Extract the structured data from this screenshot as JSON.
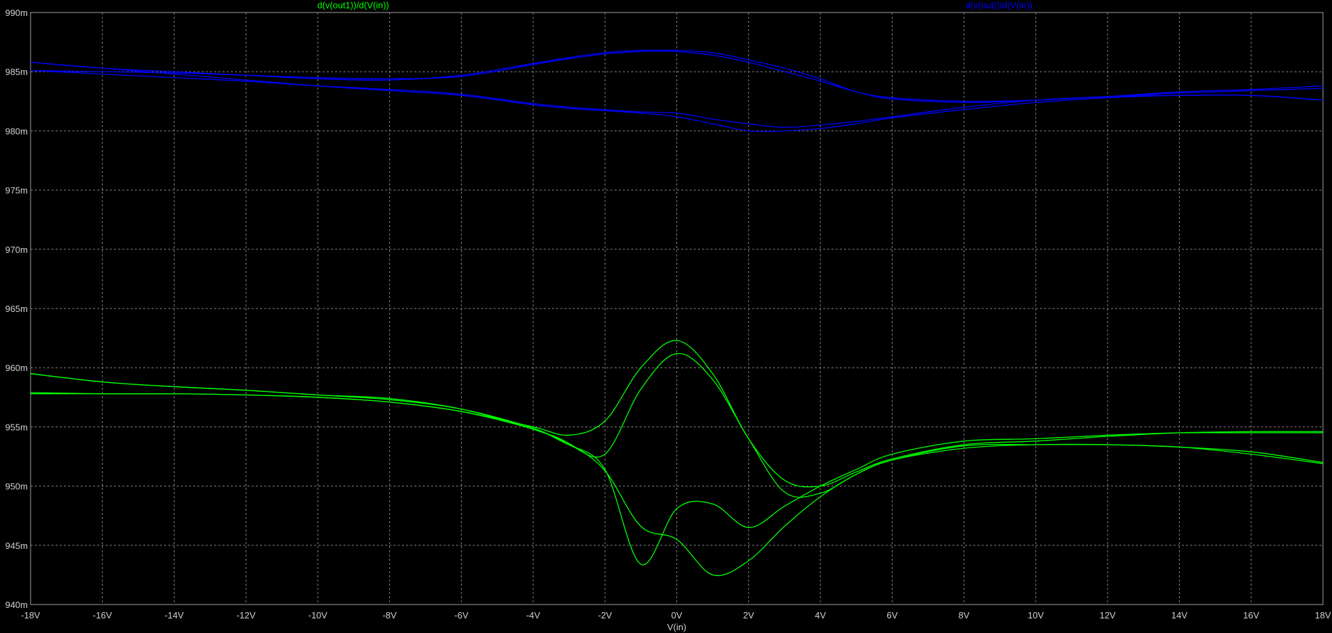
{
  "chart_data": {
    "type": "line",
    "xlabel": "V(in)",
    "ylabel": "",
    "xlim": [
      -18,
      18
    ],
    "ylim": [
      0.94,
      0.99
    ],
    "grid": true,
    "legend_placement": "top",
    "x_ticks": [
      "-18V",
      "-16V",
      "-14V",
      "-12V",
      "-10V",
      "-8V",
      "-6V",
      "-4V",
      "-2V",
      "0V",
      "2V",
      "4V",
      "6V",
      "8V",
      "10V",
      "12V",
      "14V",
      "16V",
      "18V"
    ],
    "y_ticks": [
      "940m",
      "945m",
      "950m",
      "955m",
      "960m",
      "965m",
      "970m",
      "975m",
      "980m",
      "985m",
      "990m"
    ],
    "x_tick_values": [
      -18,
      -16,
      -14,
      -12,
      -10,
      -8,
      -6,
      -4,
      -2,
      0,
      2,
      4,
      6,
      8,
      10,
      12,
      14,
      16,
      18
    ],
    "y_tick_values": [
      0.94,
      0.945,
      0.95,
      0.955,
      0.96,
      0.965,
      0.97,
      0.975,
      0.98,
      0.985,
      0.99
    ],
    "x": [
      -18,
      -16,
      -14,
      -12,
      -10,
      -8,
      -6,
      -4,
      -3,
      -2,
      -1,
      0,
      1,
      2,
      3,
      4,
      5,
      6,
      8,
      10,
      12,
      14,
      16,
      18
    ],
    "series": [
      {
        "name": "d(v(out1))/d(V(in))",
        "color": "#00ff00",
        "values": [
          0.9595,
          0.9588,
          0.9584,
          0.9581,
          0.9577,
          0.9574,
          0.9565,
          0.9548,
          0.9536,
          0.9513,
          0.9466,
          0.9455,
          0.9425,
          0.9437,
          0.9466,
          0.9491,
          0.951,
          0.9522,
          0.9534,
          0.9535,
          0.9535,
          0.9533,
          0.9527,
          0.9519
        ]
      },
      {
        "name": "d(v(out1))/d(V(in)) ",
        "color": "#00ff00",
        "values": [
          0.9578,
          0.9578,
          0.9578,
          0.9577,
          0.9575,
          0.9571,
          0.9563,
          0.9548,
          0.9535,
          0.9514,
          0.9434,
          0.9481,
          0.9485,
          0.9465,
          0.9483,
          0.95,
          0.9514,
          0.9527,
          0.9538,
          0.954,
          0.9543,
          0.9545,
          0.9545,
          0.9545
        ]
      },
      {
        "name": "d(v(out1))/d(V(in))  ",
        "color": "#00ff00",
        "values": [
          0.9579,
          0.9578,
          0.9578,
          0.9577,
          0.9575,
          0.9571,
          0.9563,
          0.955,
          0.9543,
          0.9555,
          0.96,
          0.9623,
          0.9595,
          0.954,
          0.9505,
          0.95,
          0.9512,
          0.9523,
          0.9535,
          0.9538,
          0.9542,
          0.9545,
          0.9546,
          0.9546
        ]
      },
      {
        "name": "d(v(out1))/d(V(in))   ",
        "color": "#00ff00",
        "values": [
          0.9595,
          0.9588,
          0.9584,
          0.9581,
          0.9577,
          0.9573,
          0.9565,
          0.9549,
          0.9535,
          0.9527,
          0.9582,
          0.9612,
          0.959,
          0.954,
          0.9495,
          0.9494,
          0.951,
          0.9522,
          0.9532,
          0.9535,
          0.9535,
          0.9533,
          0.9529,
          0.952
        ]
      },
      {
        "name": "d(v(out))/d(V(in))",
        "color": "#0000ff",
        "values": [
          0.9858,
          0.9853,
          0.985,
          0.9847,
          0.9844,
          0.9843,
          0.9847,
          0.9857,
          0.9862,
          0.9866,
          0.9868,
          0.9868,
          0.9866,
          0.986,
          0.9853,
          0.9844,
          0.9833,
          0.9828,
          0.9825,
          0.9826,
          0.9829,
          0.983,
          0.983,
          0.9826
        ]
      },
      {
        "name": "d(v(out))/d(V(in)) ",
        "color": "#0000ff",
        "values": [
          0.9851,
          0.985,
          0.9849,
          0.9847,
          0.9845,
          0.9844,
          0.9846,
          0.9856,
          0.9861,
          0.9865,
          0.9867,
          0.9867,
          0.9864,
          0.9858,
          0.985,
          0.9842,
          0.9833,
          0.9827,
          0.9824,
          0.9826,
          0.9829,
          0.9833,
          0.9835,
          0.9838
        ]
      },
      {
        "name": "d(v(out))/d(V(in))  ",
        "color": "#0000ff",
        "values": [
          0.9851,
          0.9848,
          0.9845,
          0.9842,
          0.9838,
          0.9835,
          0.9831,
          0.9823,
          0.982,
          0.9818,
          0.9816,
          0.9815,
          0.981,
          0.9806,
          0.9803,
          0.9805,
          0.9808,
          0.9812,
          0.982,
          0.9826,
          0.9829,
          0.9832,
          0.9834,
          0.9836
        ]
      },
      {
        "name": "d(v(out))/d(V(in))   ",
        "color": "#0000ff",
        "values": [
          0.9858,
          0.9853,
          0.9848,
          0.9843,
          0.9838,
          0.9834,
          0.983,
          0.9822,
          0.9819,
          0.9817,
          0.9815,
          0.9812,
          0.9806,
          0.98,
          0.98,
          0.9802,
          0.9806,
          0.9811,
          0.9818,
          0.9824,
          0.9828,
          0.983,
          0.983,
          0.9826
        ]
      }
    ],
    "legend": [
      {
        "label": "d(v(out1))/d(V(in))",
        "color": "#00ff00"
      },
      {
        "label": "d(v(out))/d(V(in))",
        "color": "#0000ff"
      }
    ]
  }
}
